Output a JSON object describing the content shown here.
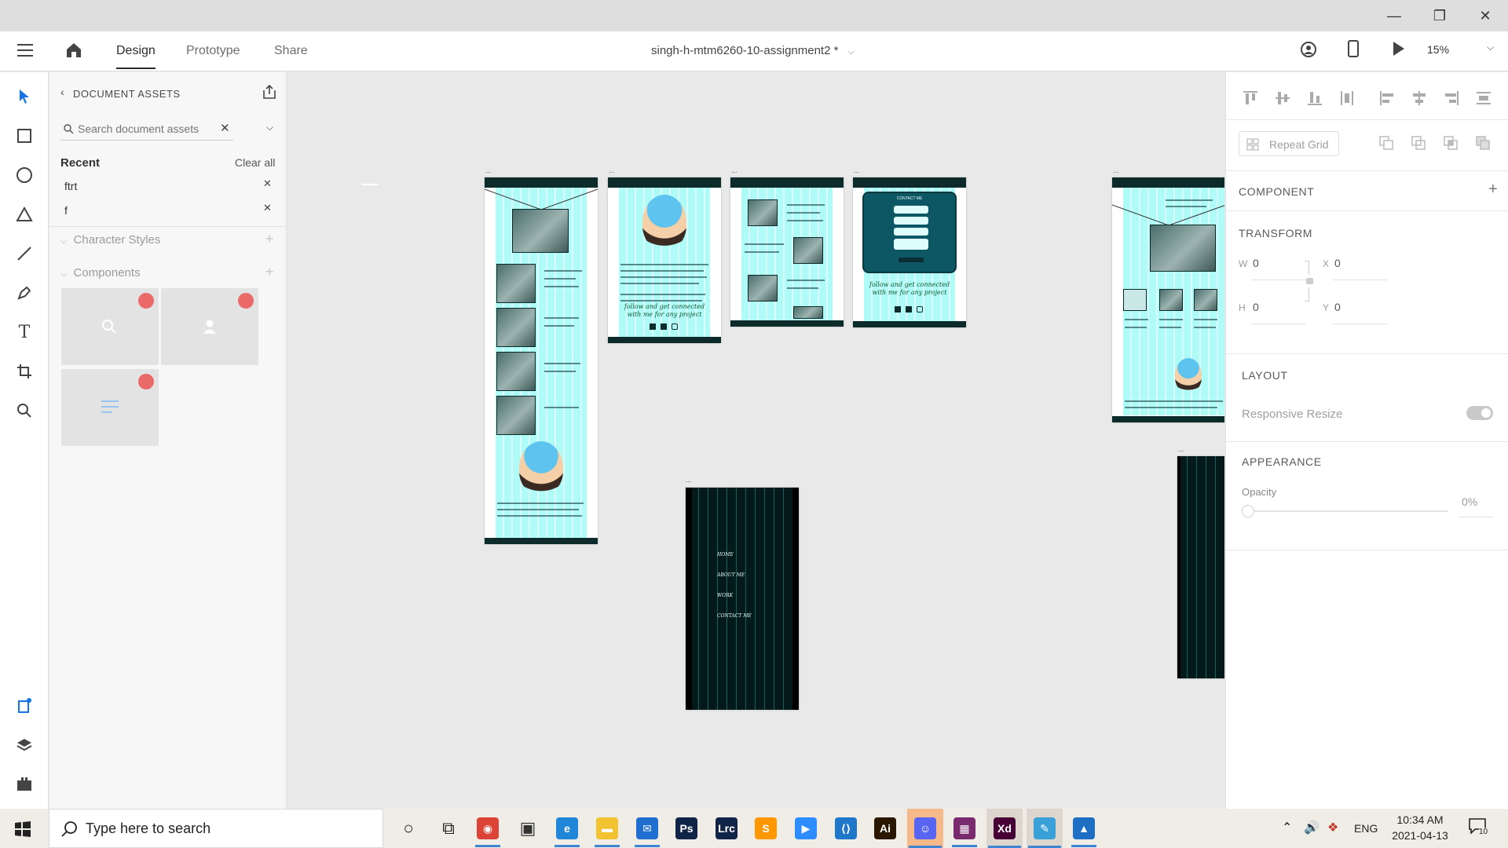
{
  "window": {
    "minimize": "—",
    "restore": "❐",
    "close": "✕"
  },
  "menubar": {
    "tabs": [
      {
        "label": "Design",
        "active": true
      },
      {
        "label": "Prototype"
      },
      {
        "label": "Share"
      }
    ],
    "document_title": "singh-h-mtm6260-10-assignment2 *",
    "zoom": "15%"
  },
  "assets": {
    "title": "DOCUMENT ASSETS",
    "search_placeholder": "Search document assets",
    "recent_label": "Recent",
    "clear_all": "Clear all",
    "recent_items": [
      "ftrt",
      "f"
    ],
    "character_styles": "Character Styles",
    "components": "Components"
  },
  "props": {
    "repeat_grid": "Repeat Grid",
    "component": "COMPONENT",
    "transform": "TRANSFORM",
    "w_label": "W",
    "w_value": "0",
    "h_label": "H",
    "h_value": "0",
    "x_label": "X",
    "x_value": "0",
    "y_label": "Y",
    "y_value": "0",
    "layout": "LAYOUT",
    "responsive_resize": "Responsive Resize",
    "appearance": "APPEARANCE",
    "opacity_label": "Opacity",
    "opacity_value": "0%"
  },
  "canvas": {
    "artboard_marker": "...",
    "mockup_captions": {
      "follow_1": "follow and get connected",
      "follow_2": "with me for any project",
      "contact_me": "CONTACT ME",
      "menu": [
        "HOME",
        "ABOUT ME",
        "WORK",
        "CONTACT ME"
      ]
    }
  },
  "taskbar": {
    "search_placeholder": "Type here to search",
    "time": "10:34 AM",
    "date": "2021-04-13",
    "language": "ENG",
    "notification_count": "10",
    "apps": [
      {
        "icon": "cortana-icon",
        "glyph": "○",
        "color": "#222222"
      },
      {
        "icon": "task-view-icon",
        "glyph": "⧉",
        "color": "#222222"
      },
      {
        "icon": "chrome-icon",
        "glyph": "◉",
        "color": "#db4437"
      },
      {
        "icon": "store-icon",
        "glyph": "▣",
        "color": "#333333"
      },
      {
        "icon": "edge-icon",
        "glyph": "e",
        "color": "#1f86d8"
      },
      {
        "icon": "file-explorer-icon",
        "glyph": "▬",
        "color": "#f2c230"
      },
      {
        "icon": "mail-icon",
        "glyph": "✉",
        "color": "#1f6fd1"
      },
      {
        "icon": "photoshop-icon",
        "glyph": "Ps",
        "color": "#0f2447"
      },
      {
        "icon": "lightroom-classic-icon",
        "glyph": "Lrc",
        "color": "#0f2447"
      },
      {
        "icon": "sublime-icon",
        "glyph": "S",
        "color": "#ff9800"
      },
      {
        "icon": "zoom-icon",
        "glyph": "▶",
        "color": "#2d8cff"
      },
      {
        "icon": "vscode-icon",
        "glyph": "⟨⟩",
        "color": "#1e77c9"
      },
      {
        "icon": "illustrator-icon",
        "glyph": "Ai",
        "color": "#2b1700"
      },
      {
        "icon": "discord-icon",
        "glyph": "☺",
        "color": "#5865f2"
      },
      {
        "icon": "winrar-icon",
        "glyph": "▦",
        "color": "#7a2a6f"
      },
      {
        "icon": "xd-icon",
        "glyph": "Xd",
        "color": "#470137"
      },
      {
        "icon": "paint-icon",
        "glyph": "✎",
        "color": "#3aa0d8"
      },
      {
        "icon": "photos-icon",
        "glyph": "▲",
        "color": "#1e6fc3"
      }
    ]
  }
}
